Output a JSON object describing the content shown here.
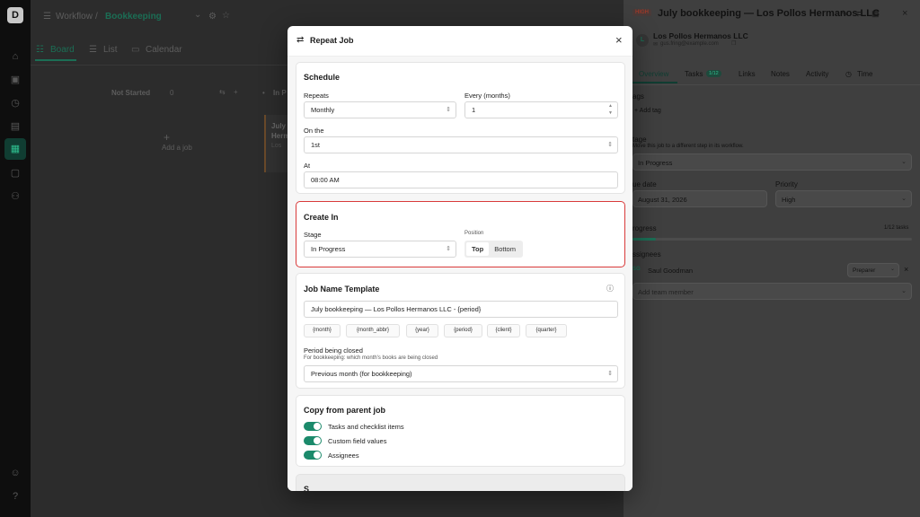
{
  "app": {
    "logo_text": "D",
    "breadcrumb": {
      "root": "Workflow",
      "sep": "/",
      "current": "Bookkeeping"
    },
    "views": [
      {
        "label": "Board",
        "icon": "board-icon"
      },
      {
        "label": "List",
        "icon": "list-icon"
      },
      {
        "label": "Calendar",
        "icon": "calendar-icon"
      }
    ],
    "columns": [
      {
        "label": "Not Started",
        "count": "0"
      },
      {
        "label": "In P",
        "count": ""
      }
    ],
    "add_job": "Add a job",
    "card_peek": {
      "line1": "July",
      "line2": "Herm",
      "line3": "Los"
    }
  },
  "side_panel": {
    "badge": "HIGH",
    "title": "July bookkeeping — Los Pollos Hermanos LLC",
    "client_initial": "L",
    "client_name": "Los Pollos Hermanos LLC",
    "client_email": "gus.fring@example.com",
    "tabs": [
      {
        "label": "Overview"
      },
      {
        "label": "Tasks",
        "badge": "1/12"
      },
      {
        "label": "Links"
      },
      {
        "label": "Notes"
      },
      {
        "label": "Activity"
      },
      {
        "label": "Time"
      }
    ],
    "tags_label": "ags",
    "add_tag": "+ Add tag",
    "stage_label": "tage",
    "stage_help": "Move this job to a different step in its workflow.",
    "stage_value": "In Progress",
    "due_label": "ue date",
    "due_value": "August 31, 2026",
    "priority_label": "Priority",
    "priority_value": "High",
    "progress_label": "rogress",
    "progress_text": "1/12 tasks",
    "progress_fraction": 0.083,
    "assignees_label": "ssignees",
    "assignee_initials": "SG",
    "assignee_name": "Saul Goodman",
    "assignee_role": "Preparer",
    "add_member": "Add team member"
  },
  "modal": {
    "title": "Repeat Job",
    "schedule": {
      "title": "Schedule",
      "repeats_label": "Repeats",
      "repeats_value": "Monthly",
      "every_label": "Every (months)",
      "every_value": "1",
      "on_the_label": "On the",
      "on_the_value": "1st",
      "at_label": "At",
      "at_value": "08:00 AM"
    },
    "create_in": {
      "title": "Create In",
      "stage_label": "Stage",
      "stage_value": "In Progress",
      "position_label": "Position",
      "position_top": "Top",
      "position_bottom": "Bottom"
    },
    "template": {
      "title": "Job Name Template",
      "value": "July bookkeeping — Los Pollos Hermanos LLC - {period}",
      "tokens": [
        "{month}",
        "{month_abbr}",
        "{year}",
        "{period}",
        "{client}",
        "{quarter}"
      ],
      "period_label": "Period being closed",
      "period_help": "For bookkeeping: which month's books are being closed",
      "period_value": "Previous month (for bookkeeping)"
    },
    "copy": {
      "title": "Copy from parent job",
      "items": [
        "Tasks and checklist items",
        "Custom field values",
        "Assignees"
      ]
    },
    "peek_title": "S"
  }
}
